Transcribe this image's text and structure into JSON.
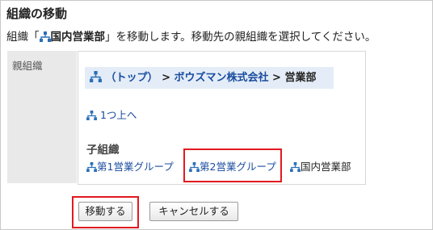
{
  "header": {
    "title": "組織の移動",
    "desc_prefix": "組織「",
    "org_name": "国内営業部",
    "desc_suffix": "」を移動します。移動先の親組織を選択してください。"
  },
  "form": {
    "parent_label": "親組織",
    "breadcrumb": {
      "top": "（トップ）",
      "sep1": " > ",
      "company": "ボウズマン株式会社",
      "sep2": " > ",
      "current": "営業部"
    },
    "up_link": "1つ上へ",
    "children_heading": "子組織",
    "children": [
      {
        "label": "第1営業グループ"
      },
      {
        "label": "第2営業グループ"
      },
      {
        "label": "国内営業部"
      }
    ]
  },
  "buttons": {
    "move": "移動する",
    "cancel": "キャンセルする"
  },
  "colors": {
    "link": "#1a4ca0",
    "highlight": "#e1191f",
    "breadcrumb_bg": "#e4edf7"
  }
}
